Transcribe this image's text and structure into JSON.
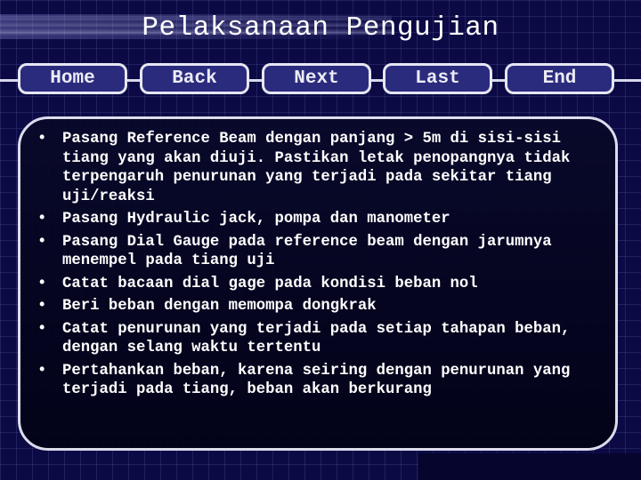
{
  "slide": {
    "title": "Pelaksanaan Pengujian"
  },
  "nav": {
    "buttons": [
      {
        "label": "Home"
      },
      {
        "label": "Back"
      },
      {
        "label": "Next"
      },
      {
        "label": "Last"
      },
      {
        "label": "End"
      }
    ]
  },
  "content": {
    "bullet_icon": "•",
    "items": [
      {
        "text": "Pasang Reference Beam dengan panjang > 5m di sisi-sisi tiang yang akan diuji. Pastikan letak penopangnya tidak terpengaruh penurunan yang terjadi pada sekitar tiang uji/reaksi"
      },
      {
        "text": "Pasang Hydraulic jack, pompa dan manometer"
      },
      {
        "text": "Pasang Dial Gauge pada reference beam dengan jarumnya menempel pada tiang uji"
      },
      {
        "text": "Catat bacaan dial gage pada kondisi beban nol"
      },
      {
        "text": "Beri beban dengan memompa dongkrak"
      },
      {
        "text": "Catat penurunan yang terjadi pada setiap tahapan beban, dengan selang waktu tertentu"
      },
      {
        "text": "Pertahankan beban, karena seiring dengan penurunan yang terjadi pada tiang, beban akan berkurang"
      }
    ]
  },
  "colors": {
    "background": "#0b0a45",
    "button_fill": "#2b2b7e",
    "button_border": "#e6e6f2",
    "text": "#ffffff"
  }
}
